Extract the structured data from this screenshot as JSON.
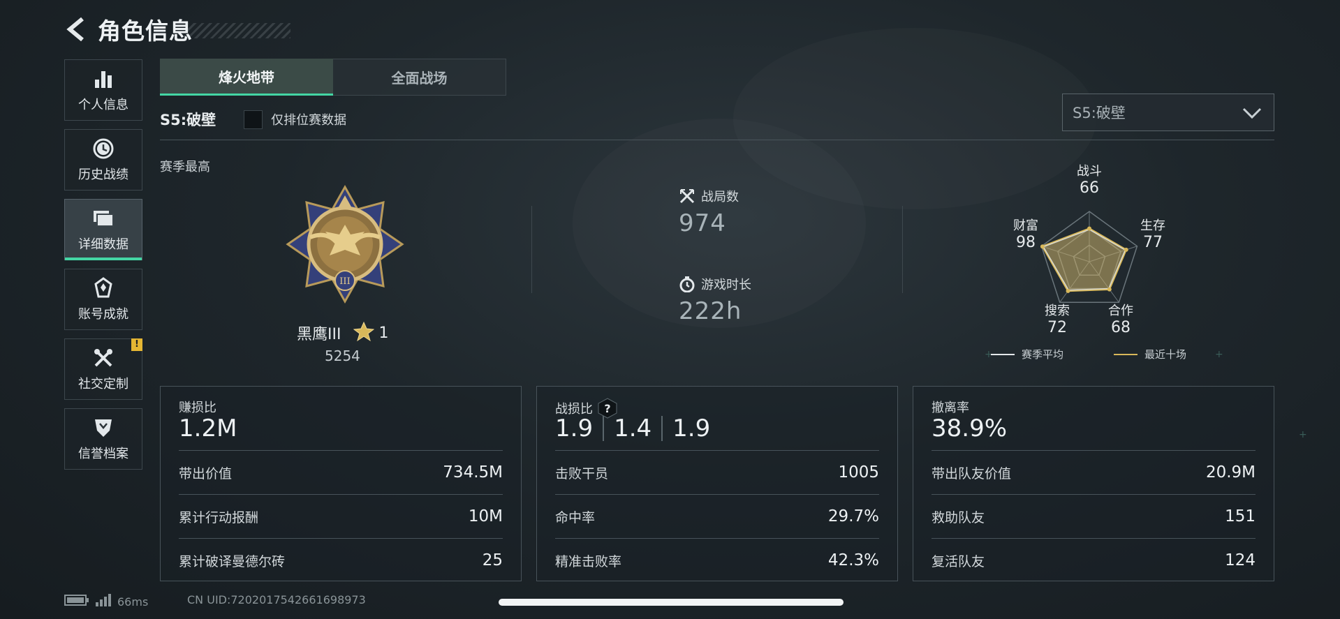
{
  "header": {
    "title": "角色信息"
  },
  "sidebar": {
    "items": [
      {
        "label": "个人信息",
        "icon": "bar-chart-icon"
      },
      {
        "label": "历史战绩",
        "icon": "clock-icon"
      },
      {
        "label": "详细数据",
        "icon": "folder-icon",
        "active": true
      },
      {
        "label": "账号成就",
        "icon": "achievement-icon"
      },
      {
        "label": "社交定制",
        "icon": "tools-icon",
        "badge": "!"
      },
      {
        "label": "信誉档案",
        "icon": "shield-icon"
      }
    ]
  },
  "tabs": [
    {
      "label": "烽火地带",
      "active": true
    },
    {
      "label": "全面战场",
      "active": false
    }
  ],
  "season": {
    "name": "S5:破壁",
    "ranked_only_label": "仅排位赛数据",
    "dropdown_value": "S5:破壁"
  },
  "season_best": {
    "label": "赛季最高",
    "rank_name": "黑鹰III",
    "stars": "1",
    "score": "5254",
    "medal_numeral": "III"
  },
  "stats": {
    "matches_label": "战局数",
    "matches_value": "974",
    "playtime_label": "游戏时长",
    "playtime_value": "222h"
  },
  "radar": {
    "axes": [
      {
        "name": "战斗",
        "value": "66"
      },
      {
        "name": "生存",
        "value": "77"
      },
      {
        "name": "合作",
        "value": "68"
      },
      {
        "name": "搜索",
        "value": "72"
      },
      {
        "name": "财富",
        "value": "98"
      }
    ],
    "legend": [
      {
        "label": "赛季平均",
        "color": "#e4e8ea"
      },
      {
        "label": "最近十场",
        "color": "#d8b85a"
      }
    ]
  },
  "cards": [
    {
      "title": "赚损比",
      "big": "1.2M",
      "rows": [
        {
          "label": "带出价值",
          "value": "734.5M"
        },
        {
          "label": "累计行动报酬",
          "value": "10M"
        },
        {
          "label": "累计破译曼德尔砖",
          "value": "25"
        }
      ]
    },
    {
      "title": "战损比",
      "big_values": [
        "1.9",
        "1.4",
        "1.9"
      ],
      "rows": [
        {
          "label": "击败干员",
          "value": "1005"
        },
        {
          "label": "命中率",
          "value": "29.7%"
        },
        {
          "label": "精准击败率",
          "value": "42.3%"
        }
      ]
    },
    {
      "title": "撤离率",
      "big": "38.9%",
      "rows": [
        {
          "label": "带出队友价值",
          "value": "20.9M"
        },
        {
          "label": "救助队友",
          "value": "151"
        },
        {
          "label": "复活队友",
          "value": "124"
        }
      ]
    }
  ],
  "footer": {
    "ping": "66ms",
    "uid": "CN UID:7202017542661698973"
  },
  "colors": {
    "accent": "#44d6a4",
    "gold": "#d8b85a",
    "badge": "#e5b633"
  }
}
